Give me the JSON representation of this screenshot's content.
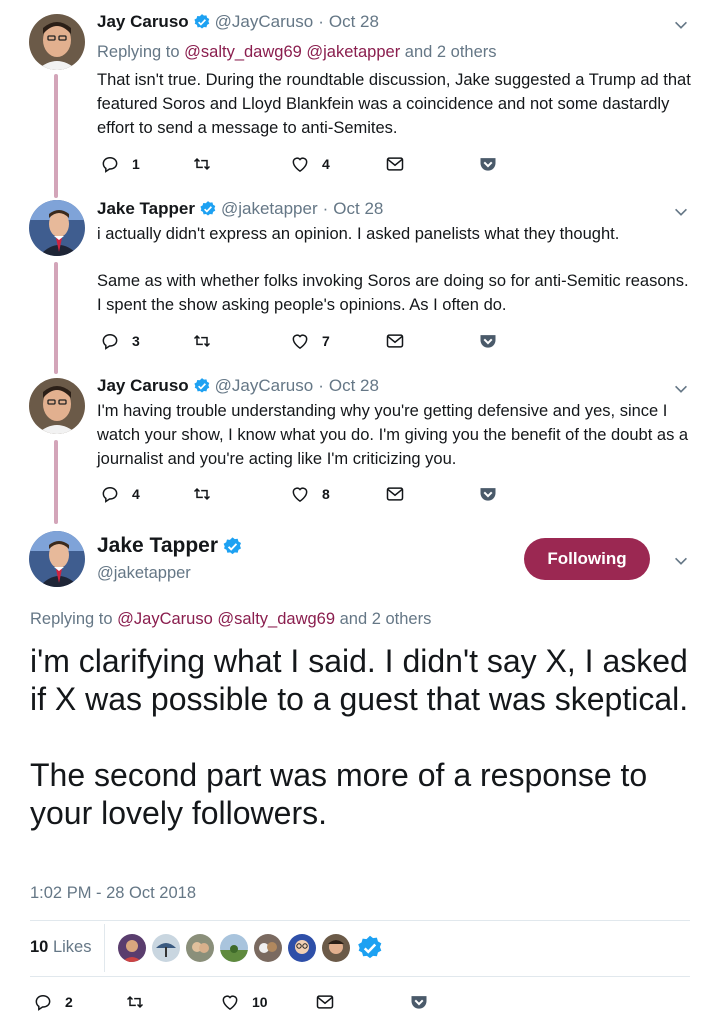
{
  "thread": [
    {
      "name": "Jay Caruso",
      "handle": "@JayCaruso",
      "date": "Oct 28",
      "replying_prefix": "Replying to",
      "replying_mentions": "@salty_dawg69 @jaketapper",
      "replying_suffix": "and 2 others",
      "paragraphs": [
        "That isn't true. During the roundtable discussion, Jake suggested a Trump ad that featured Soros and Lloyd Blankfein was a coincidence and not some dastardly effort to send a message to anti-Semites."
      ],
      "reply_count": "1",
      "retweet_count": "",
      "like_count": "4"
    },
    {
      "name": "Jake Tapper",
      "handle": "@jaketapper",
      "date": "Oct 28",
      "paragraphs": [
        "i actually didn't express an opinion. I asked panelists what they thought.",
        "Same as with whether folks invoking Soros are doing so for anti-Semitic reasons. I spent the show asking people's opinions. As I often do."
      ],
      "reply_count": "3",
      "retweet_count": "",
      "like_count": "7"
    },
    {
      "name": "Jay Caruso",
      "handle": "@JayCaruso",
      "date": "Oct 28",
      "paragraphs": [
        "I'm having trouble understanding why you're getting defensive and yes, since I watch your show, I know what you do. I'm giving you the benefit of the doubt as a journalist and you're acting like I'm criticizing you."
      ],
      "reply_count": "4",
      "retweet_count": "",
      "like_count": "8"
    }
  ],
  "main": {
    "name": "Jake Tapper",
    "handle": "@jaketapper",
    "follow_label": "Following",
    "replying_prefix": "Replying to",
    "replying_mentions": "@JayCaruso @salty_dawg69",
    "replying_suffix": "and 2 others",
    "paragraphs": [
      "i'm clarifying what I said. I didn't say X, I asked if X was possible to a guest that was skeptical.",
      "The second part was more of a response to your lovely followers."
    ],
    "timestamp": "1:02 PM - 28 Oct 2018",
    "likes_number": "10",
    "likes_word": "Likes",
    "reply_count": "2",
    "retweet_count": "",
    "like_count": "10"
  },
  "colors": {
    "accent": "#9b2852",
    "mention": "#8a1e4e",
    "verified": "#1da1f2",
    "thread_line": "#d3a5b9",
    "muted": "#657786"
  },
  "icons": {
    "verified": "verified-badge-icon",
    "caret": "chevron-down-icon",
    "reply": "reply-icon",
    "retweet": "retweet-icon",
    "like": "heart-icon",
    "dm": "envelope-icon",
    "pocket": "pocket-icon"
  }
}
